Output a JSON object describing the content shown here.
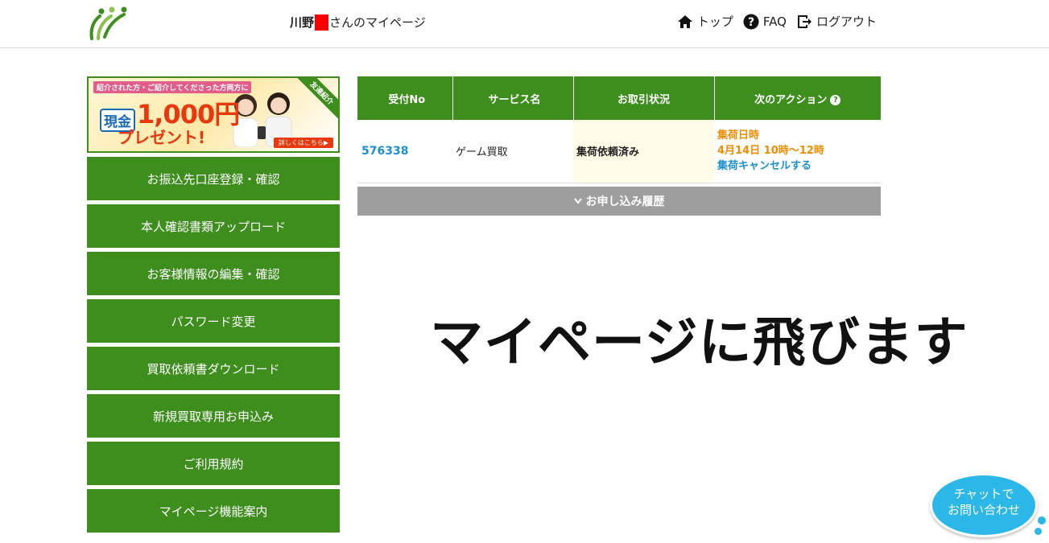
{
  "header": {
    "user_name": "川野",
    "user_suffix": "さんのマイページ",
    "nav": {
      "top": "トップ",
      "faq": "FAQ",
      "logout": "ログアウト"
    }
  },
  "banner": {
    "top_text": "紹介された方・ご紹介してくださった方両方に",
    "cash": "現金",
    "amount": "1,000円",
    "present": "プレゼント!",
    "corner": "友達紹介",
    "details": "詳しくはこちら▶"
  },
  "sidebar": {
    "items": [
      {
        "label": "お振込先口座登録・確認"
      },
      {
        "label": "本人確認書類アップロード"
      },
      {
        "label": "お客様情報の編集・確認"
      },
      {
        "label": "パスワード変更"
      },
      {
        "label": "買取依頼書ダウンロード"
      },
      {
        "label": "新規買取専用お申込み"
      },
      {
        "label": "ご利用規約"
      },
      {
        "label": "マイページ機能案内"
      }
    ]
  },
  "orders": {
    "headers": [
      "受付No",
      "サービス名",
      "お取引状況",
      "次のアクション"
    ],
    "rows": [
      {
        "no": "576338",
        "service": "ゲーム買取",
        "status": "集荷依頼済み",
        "action_label": "集荷日時",
        "action_datetime": "4月14日 10時〜12時",
        "action_link": "集荷キャンセルする"
      }
    ]
  },
  "history_label": "お申し込み履歴",
  "overlay_message": "マイページに飛びます",
  "chat": {
    "line1": "チャットで",
    "line2": "お問い合わせ"
  },
  "colors": {
    "brand_green": "#3e8e1e",
    "link_blue": "#1a8fd1",
    "accent_orange": "#f08c00",
    "chat_blue": "#2bb7e8"
  }
}
